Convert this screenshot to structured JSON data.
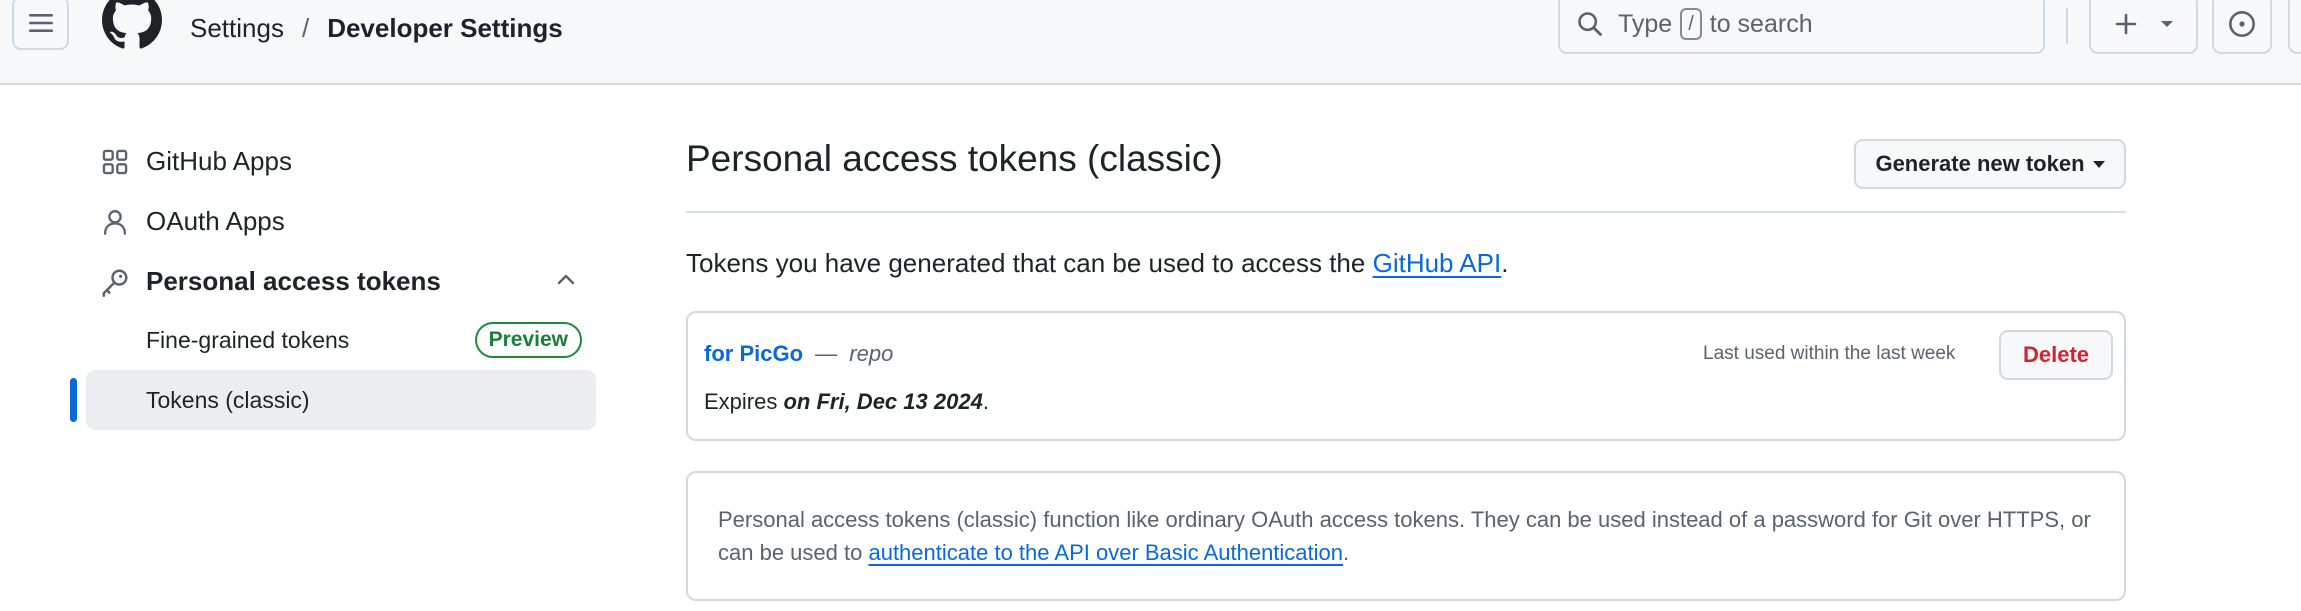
{
  "header": {
    "breadcrumb": {
      "settings": "Settings",
      "separator": "/",
      "current": "Developer Settings"
    },
    "search": {
      "prefix": "Type",
      "key": "/",
      "suffix": "to search"
    },
    "icons": [
      "hamburger-icon",
      "github-logo",
      "search-icon",
      "plus-icon",
      "triangle-down-icon",
      "issue-opened-icon"
    ]
  },
  "sidebar": {
    "items": [
      {
        "label": "GitHub Apps",
        "icon": "apps-icon"
      },
      {
        "label": "OAuth Apps",
        "icon": "person-icon"
      },
      {
        "label": "Personal access tokens",
        "icon": "key-icon"
      }
    ],
    "sub_items": [
      {
        "label": "Fine-grained tokens",
        "badge": "Preview"
      },
      {
        "label": "Tokens (classic)"
      }
    ]
  },
  "main": {
    "title": "Personal access tokens (classic)",
    "generate_button": "Generate new token",
    "intro_text": "Tokens you have generated that can be used to access the",
    "intro_link": "GitHub API",
    "intro_end": ".",
    "token": {
      "name": "for PicGo",
      "dash": "—",
      "scope": "repo",
      "last_used": "Last used within the last week",
      "delete_label": "Delete",
      "expires_prefix": "Expires",
      "expires_date": "on Fri, Dec 13 2024",
      "expires_end": "."
    },
    "info": {
      "text": "Personal access tokens (classic) function like ordinary OAuth access tokens. They can be used instead of a password for Git over HTTPS, or can be used to",
      "link": "authenticate to the API over Basic Authentication",
      "end": "."
    }
  },
  "colors": {
    "accent": "#0969da",
    "danger": "#d1242f",
    "success": "#1a7f37",
    "border": "#d1d9e0"
  }
}
